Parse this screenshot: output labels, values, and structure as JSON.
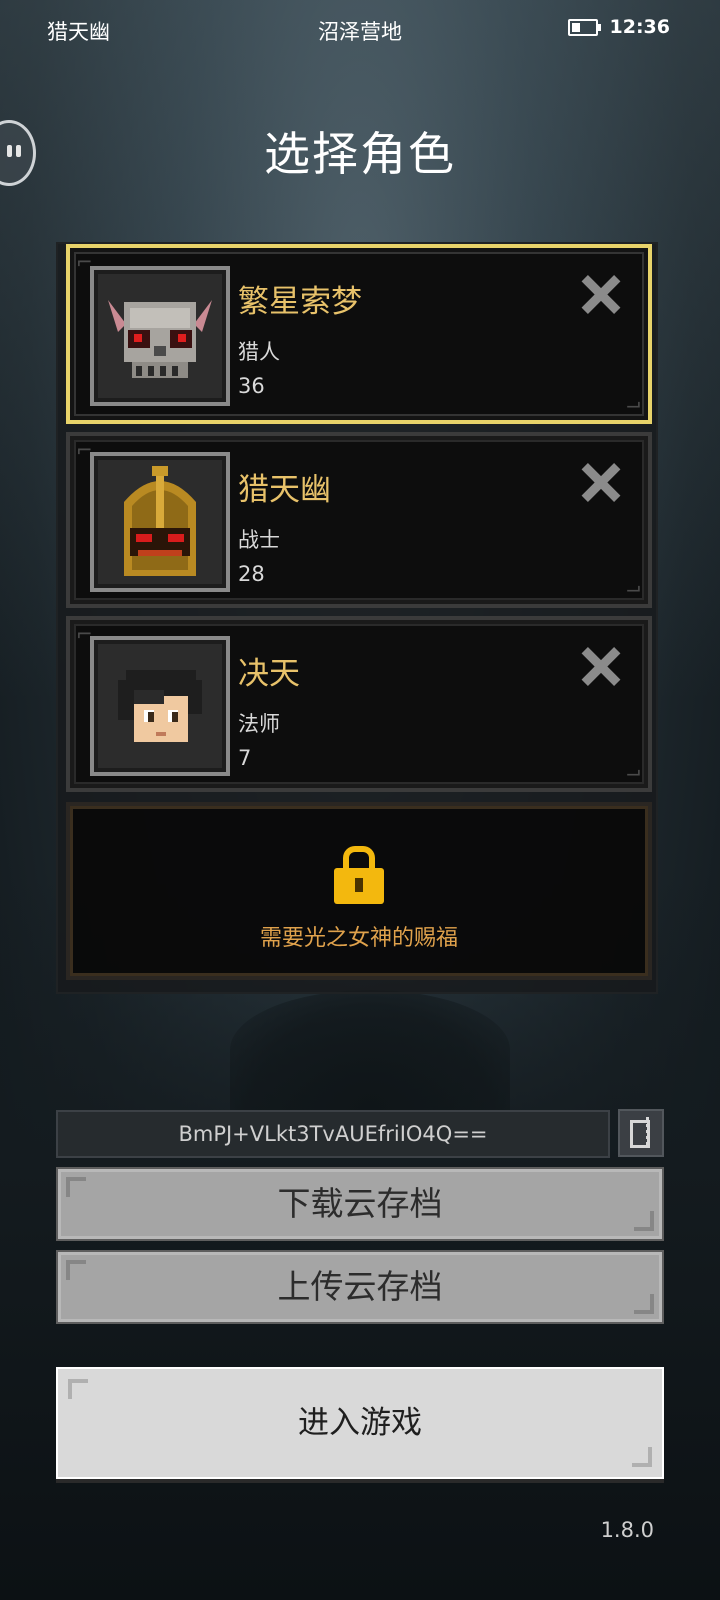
{
  "status_bar": {
    "left": "猎天幽",
    "center": "沼泽营地",
    "time": "12:36"
  },
  "page_title": "选择角色",
  "characters": [
    {
      "name": "繁星索梦",
      "class": "猎人",
      "level": "36",
      "avatar_icon": "horned-skull-avatar-icon",
      "selected": true
    },
    {
      "name": "猎天幽",
      "class": "战士",
      "level": "28",
      "avatar_icon": "golden-helmet-avatar-icon",
      "selected": false
    },
    {
      "name": "决天",
      "class": "法师",
      "level": "7",
      "avatar_icon": "black-haired-boy-avatar-icon",
      "selected": false
    }
  ],
  "locked_slot": {
    "icon": "padlock-icon",
    "text": "需要光之女神的赐福"
  },
  "save_code": "BmPJ+VLkt3TvAUEfriIO4Q==",
  "buttons": {
    "download": "下载云存档",
    "upload": "上传云存档",
    "enter": "进入游戏"
  },
  "version": "1.8.0",
  "colors": {
    "selected_border": "#e8d36a",
    "name_text": "#e8c26a",
    "lock": "#f3b80e",
    "lock_text": "#e0a24c"
  }
}
